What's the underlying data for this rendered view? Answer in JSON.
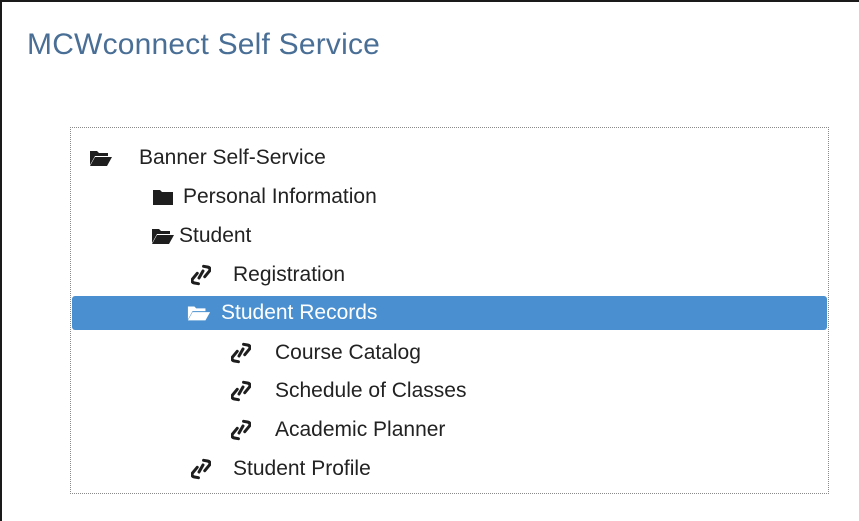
{
  "header": {
    "title": "MCWconnect Self Service"
  },
  "tree": {
    "items": [
      {
        "label": "Banner Self-Service",
        "icon": "folder-open-icon",
        "selected": false
      },
      {
        "label": "Personal Information",
        "icon": "folder-closed-icon",
        "selected": false
      },
      {
        "label": "Student",
        "icon": "folder-open-icon",
        "selected": false
      },
      {
        "label": "Registration",
        "icon": "link-icon",
        "selected": false
      },
      {
        "label": "Student Records",
        "icon": "folder-open-icon",
        "selected": true
      },
      {
        "label": "Course Catalog",
        "icon": "link-icon",
        "selected": false
      },
      {
        "label": "Schedule of Classes",
        "icon": "link-icon",
        "selected": false
      },
      {
        "label": "Academic Planner",
        "icon": "link-icon",
        "selected": false
      },
      {
        "label": "Student Profile",
        "icon": "link-icon",
        "selected": false
      }
    ],
    "selected_color": "#4a90d0"
  }
}
